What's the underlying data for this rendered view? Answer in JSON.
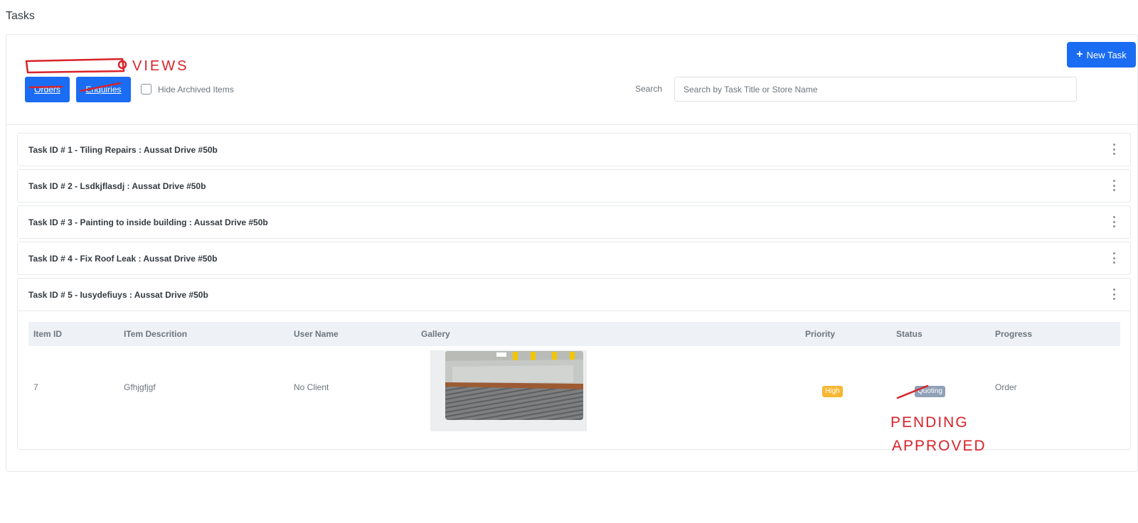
{
  "page": {
    "title": "Tasks"
  },
  "toolbar": {
    "new_task_label": "New Task",
    "views_annotation": "VIEWS",
    "orders_label": "Orders",
    "enquiries_label": "Enquiries",
    "hide_archived_label": "Hide Archived Items",
    "hide_archived_checked": false,
    "search_label": "Search",
    "search_placeholder": "Search by Task Title or Store Name",
    "search_value": ""
  },
  "tasks": [
    {
      "title": "Task ID # 1 - Tiling Repairs : Aussat Drive #50b",
      "expanded": false
    },
    {
      "title": "Task ID # 2 - Lsdkjflasdj : Aussat Drive #50b",
      "expanded": false
    },
    {
      "title": "Task ID # 3 - Painting to inside building : Aussat Drive #50b",
      "expanded": false
    },
    {
      "title": "Task ID # 4 - Fix Roof Leak : Aussat Drive #50b",
      "expanded": false
    },
    {
      "title": "Task ID # 5 - Iusydefiuys : Aussat Drive #50b",
      "expanded": true
    }
  ],
  "items_table": {
    "columns": [
      "Item ID",
      "ITem Descrition",
      "User Name",
      "Gallery",
      "Priority",
      "Status",
      "Progress"
    ],
    "rows": [
      {
        "item_id": "7",
        "description": "Gfhjgfjgf",
        "user_name": "No Client",
        "priority": "High",
        "status": "Quoting",
        "progress": "Order"
      }
    ]
  },
  "annotations": {
    "status_pending": "PENDING",
    "status_approved": "APPROVED"
  },
  "colors": {
    "primary": "#1a6cf3",
    "priority_high": "#f7b731",
    "status_badge": "#8fa0b7",
    "annotation_red": "#d8232a"
  },
  "icons": {
    "new_task": "plus-icon",
    "task_menu": "kebab-menu-icon"
  }
}
